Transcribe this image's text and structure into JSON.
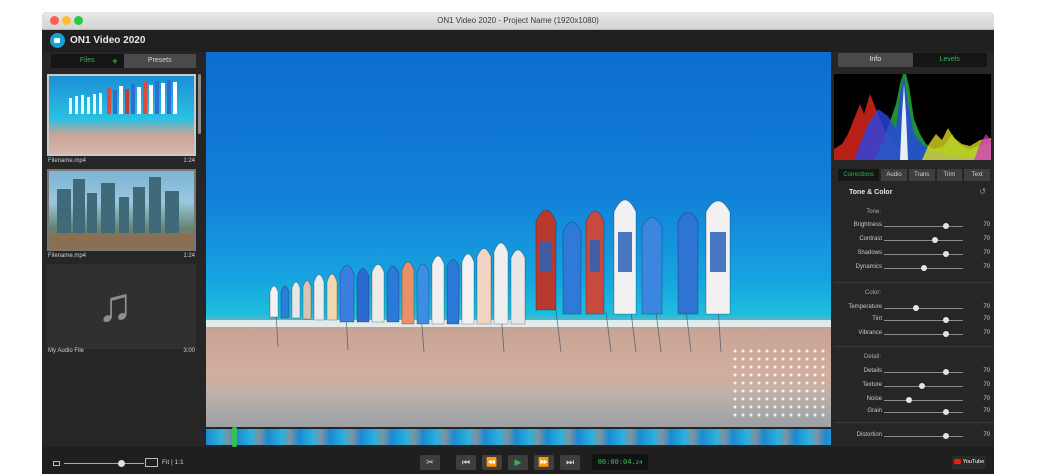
{
  "window": {
    "title": "ON1 Video 2020 - Project Name  (1920x1080)"
  },
  "app": {
    "name": "ON1 Video 2020"
  },
  "left_panel": {
    "tabs": [
      {
        "label": "Files"
      },
      {
        "label": "Presets"
      }
    ],
    "add_symbol": "+",
    "media": [
      {
        "name": "Filename.mp4",
        "duration": "1:24"
      },
      {
        "name": "Filename.mp4",
        "duration": "1:24"
      },
      {
        "name": "My Audio File",
        "duration": "3:00"
      }
    ]
  },
  "right_panel": {
    "tabs": [
      {
        "label": "Info"
      },
      {
        "label": "Levels"
      }
    ],
    "subtabs": [
      {
        "label": "Corrections"
      },
      {
        "label": "Audio"
      },
      {
        "label": "Trans"
      },
      {
        "label": "Trim"
      },
      {
        "label": "Text"
      }
    ],
    "section_title": "Tone & Color",
    "groups": {
      "tone": "Tone:",
      "color": "Color:",
      "detail": "Detail:"
    },
    "sliders": [
      {
        "label": "Brightness",
        "value": "70",
        "level": 0.78
      },
      {
        "label": "Contrast",
        "value": "70",
        "level": 0.65
      },
      {
        "label": "Shadows",
        "value": "70",
        "level": 0.78
      },
      {
        "label": "Dynamics",
        "value": "70",
        "level": 0.5
      },
      {
        "label": "Temperature",
        "value": "70",
        "level": 0.4
      },
      {
        "label": "Tint",
        "value": "70",
        "level": 0.78
      },
      {
        "label": "Vibrance",
        "value": "70",
        "level": 0.78
      },
      {
        "label": "Details",
        "value": "70",
        "level": 0.78
      },
      {
        "label": "Texture",
        "value": "70",
        "level": 0.48
      },
      {
        "label": "Noise",
        "value": "70",
        "level": 0.32
      },
      {
        "label": "Grain",
        "value": "70",
        "level": 0.78
      },
      {
        "label": "Distortion",
        "value": "70",
        "level": 0.78
      }
    ]
  },
  "bottom_bar": {
    "fit_label": "Fit | 1:1",
    "zoom_level": 0.72,
    "timecode": "00:00:04",
    "timecode_frames": "24",
    "export_label": "YouTube"
  },
  "icons": {
    "cut": "✂",
    "skip_start": "⏮",
    "rewind": "⏪",
    "play": "▶",
    "fast_forward": "⏩",
    "skip_end": "⏭",
    "reset": "↺",
    "music_note": "♫"
  },
  "colors": {
    "accent": "#33b64f",
    "panel": "#262626",
    "youtube": "#e62117"
  }
}
